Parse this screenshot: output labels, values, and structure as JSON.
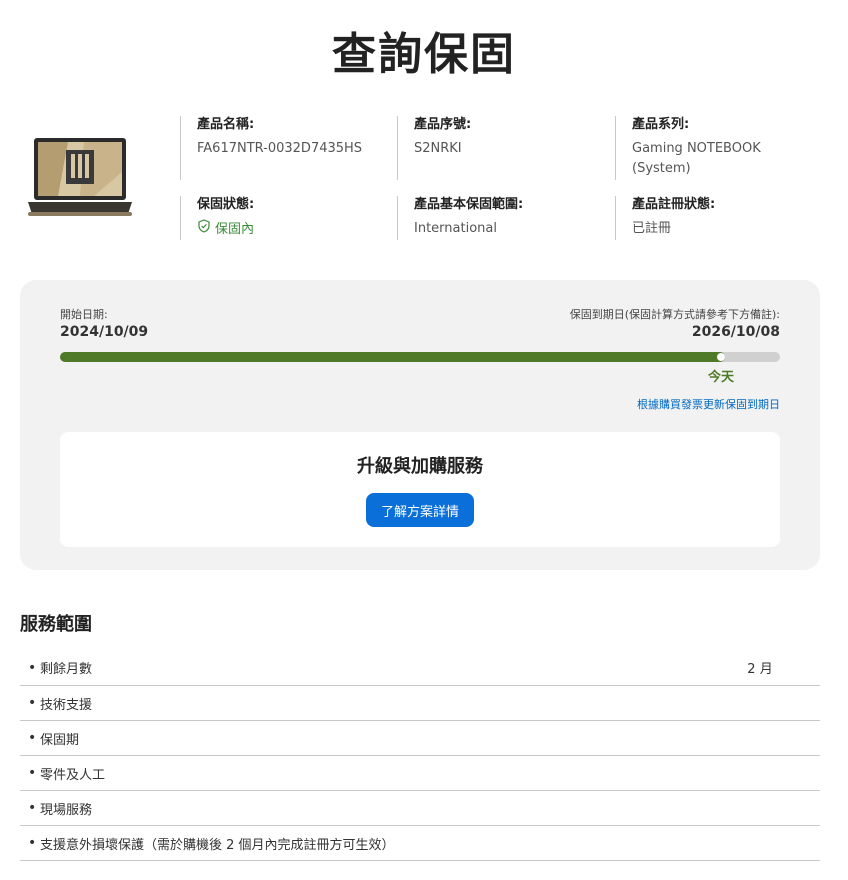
{
  "page": {
    "title": "查詢保固"
  },
  "product": {
    "image_alt": "TUF Gaming laptop",
    "fields": [
      {
        "label": "產品名稱:",
        "value": "FA617NTR-0032D7435HS"
      },
      {
        "label": "產品序號:",
        "value": "S2NRKI"
      },
      {
        "label": "產品系列:",
        "value": "Gaming NOTEBOOK (System)"
      },
      {
        "label": "保固狀態:",
        "value": "保固內"
      },
      {
        "label": "產品基本保固範圍:",
        "value": "International"
      },
      {
        "label": "產品註冊狀態:",
        "value": "已註冊"
      }
    ]
  },
  "warranty": {
    "start_label": "開始日期:",
    "start_date": "2024/10/09",
    "end_label": "保固到期日(保固計算方式請參考下方備註):",
    "end_date": "2026/10/08",
    "progress": 0.924,
    "today_label": "今天",
    "update_link": "根據購買發票更新保固到期日",
    "upgrade": {
      "title": "升級與加購服務",
      "button": "了解方案詳情"
    }
  },
  "service_scope": {
    "title": "服務範圍",
    "items": [
      {
        "label": "剩餘月數",
        "value": "2 月"
      },
      {
        "label": "技術支援",
        "icon": "check-circle-icon"
      },
      {
        "label": "保固期",
        "icon": "check-circle-icon"
      },
      {
        "label": "零件及人工",
        "icon": "check-circle-icon"
      },
      {
        "label": "現場服務",
        "icon": "cross-circle-icon"
      },
      {
        "label": "支援意外損壞保護（需於購機後 2 個月內完成註冊方可生效）",
        "icon": "cross-circle-icon"
      }
    ]
  },
  "colors": {
    "accent_green": "#4f7a28",
    "status_green": "#3a8a3a",
    "error_red": "#d9302c",
    "link_blue": "#0069c2",
    "button_blue": "#0b6fd9"
  }
}
